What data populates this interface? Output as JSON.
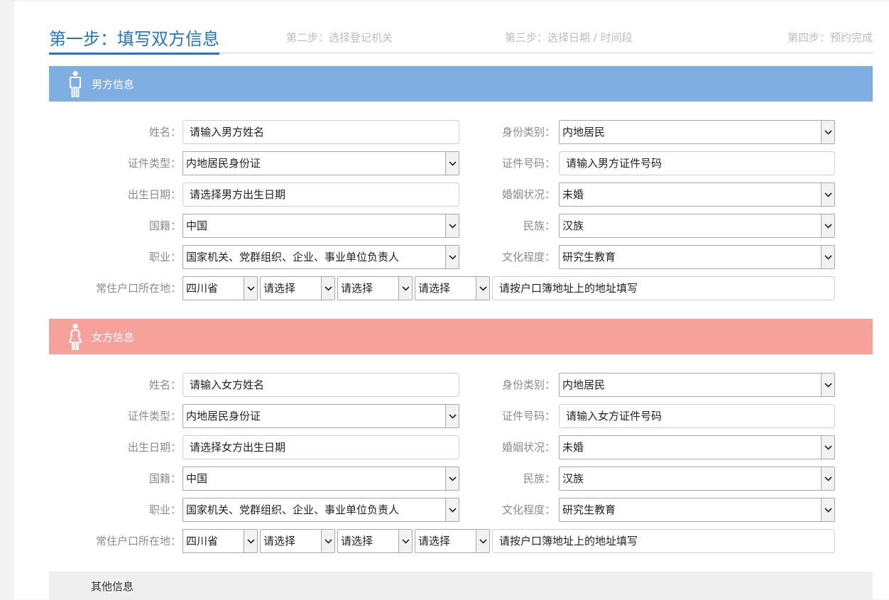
{
  "steps": [
    "第一步：填写双方信息",
    "第二步：选择登记机关",
    "第三步：选择日期 / 时间段",
    "第四步：预约完成"
  ],
  "male": {
    "title": "男方信息",
    "labels": {
      "name": "姓名：",
      "identity_category": "身份类别：",
      "id_type": "证件类型：",
      "id_number": "证件号码：",
      "birth_date": "出生日期：",
      "marital_status": "婚姻状况：",
      "nationality": "国籍：",
      "ethnicity": "民族：",
      "occupation": "职业：",
      "education": "文化程度：",
      "residence": "常住户口所在地："
    },
    "fields": {
      "name_placeholder": "请输入男方姓名",
      "identity_category": "内地居民",
      "id_type": "内地居民身份证",
      "id_number_placeholder": "请输入男方证件号码",
      "birth_date_placeholder": "请选择男方出生日期",
      "marital_status": "未婚",
      "nationality": "中国",
      "ethnicity": "汉族",
      "occupation": "国家机关、党群组织、企业、事业单位负责人",
      "education": "研究生教育",
      "province": "四川省",
      "city": "请选择",
      "district": "请选择",
      "town": "请选择",
      "address_placeholder": "请按户口簿地址上的地址填写"
    }
  },
  "female": {
    "title": "女方信息",
    "labels": {
      "name": "姓名：",
      "identity_category": "身份类别：",
      "id_type": "证件类型：",
      "id_number": "证件号码：",
      "birth_date": "出生日期：",
      "marital_status": "婚姻状况：",
      "nationality": "国籍：",
      "ethnicity": "民族：",
      "occupation": "职业：",
      "education": "文化程度：",
      "residence": "常住户口所在地："
    },
    "fields": {
      "name_placeholder": "请输入女方姓名",
      "identity_category": "内地居民",
      "id_type": "内地居民身份证",
      "id_number_placeholder": "请输入女方证件号码",
      "birth_date_placeholder": "请选择女方出生日期",
      "marital_status": "未婚",
      "nationality": "中国",
      "ethnicity": "汉族",
      "occupation": "国家机关、党群组织、企业、事业单位负责人",
      "education": "研究生教育",
      "province": "四川省",
      "city": "请选择",
      "district": "请选择",
      "town": "请选择",
      "address_placeholder": "请按户口簿地址上的地址填写"
    }
  },
  "other": {
    "title": "其他信息"
  },
  "icons": {
    "male": "male-person-icon",
    "female": "female-person-icon",
    "dropdown": "chevron-down-icon"
  },
  "colors": {
    "active_step": "#1f74d6",
    "inactive_step": "#bdbdbd",
    "male_header": "#7faee3",
    "female_header": "#f6a19b",
    "other_header": "#efefef"
  }
}
